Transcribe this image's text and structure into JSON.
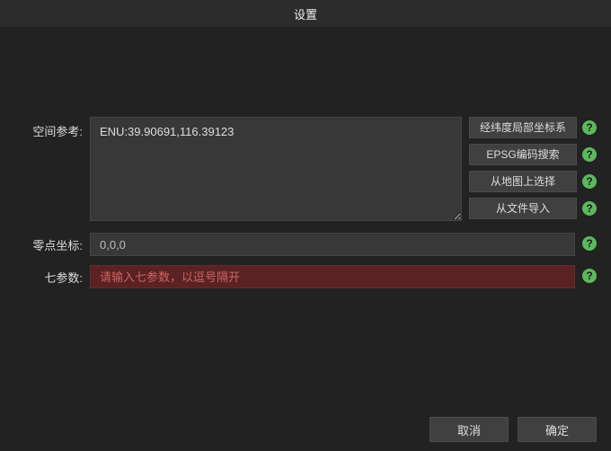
{
  "title": "设置",
  "rows": {
    "spatial": {
      "label": "空间参考:",
      "value": "ENU:39.90691,116.39123",
      "buttons": [
        "经纬度局部坐标系",
        "EPSG编码搜索",
        "从地图上选择",
        "从文件导入"
      ]
    },
    "origin": {
      "label": "零点坐标:",
      "value": "0,0,0"
    },
    "seven": {
      "label": "七参数:",
      "placeholder": "请输入七参数，以逗号隔开"
    }
  },
  "footer": {
    "cancel": "取消",
    "ok": "确定"
  },
  "help_glyph": "?"
}
